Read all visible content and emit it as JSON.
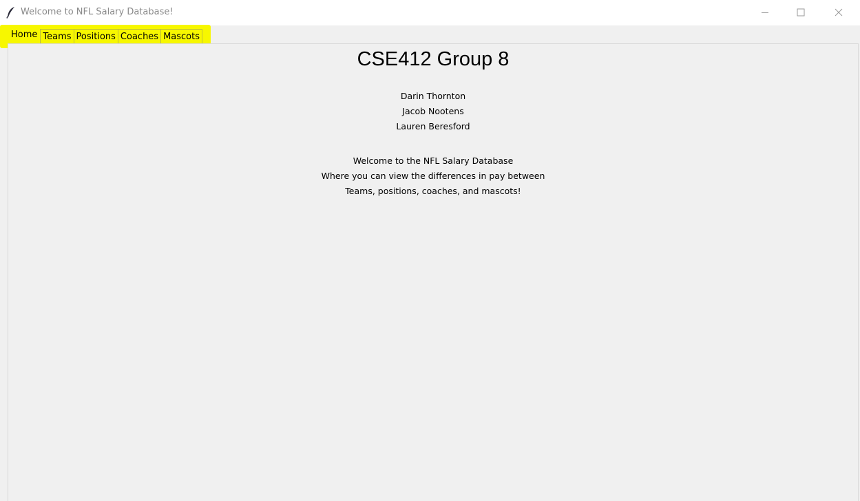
{
  "window": {
    "title": "Welcome to NFL Salary Database!",
    "app_icon": "feather-icon",
    "controls": [
      "minimize-icon",
      "maximize-icon",
      "close-icon"
    ]
  },
  "tabs": [
    {
      "label": "Home",
      "active": true
    },
    {
      "label": "Teams",
      "active": false
    },
    {
      "label": "Positions",
      "active": false
    },
    {
      "label": "Coaches",
      "active": false
    },
    {
      "label": "Mascots",
      "active": false
    }
  ],
  "home": {
    "heading": "CSE412 Group 8",
    "members": [
      "Darin Thornton",
      "Jacob Nootens",
      "Lauren Beresford"
    ],
    "welcome": [
      "Welcome to the NFL Salary Database",
      "Where you can view the differences in pay between",
      "Teams, positions, coaches, and mascots!"
    ]
  },
  "colors": {
    "highlight": "#f7f700",
    "window_bg": "#f0f0f0",
    "titlebar_bg": "#ffffff"
  }
}
